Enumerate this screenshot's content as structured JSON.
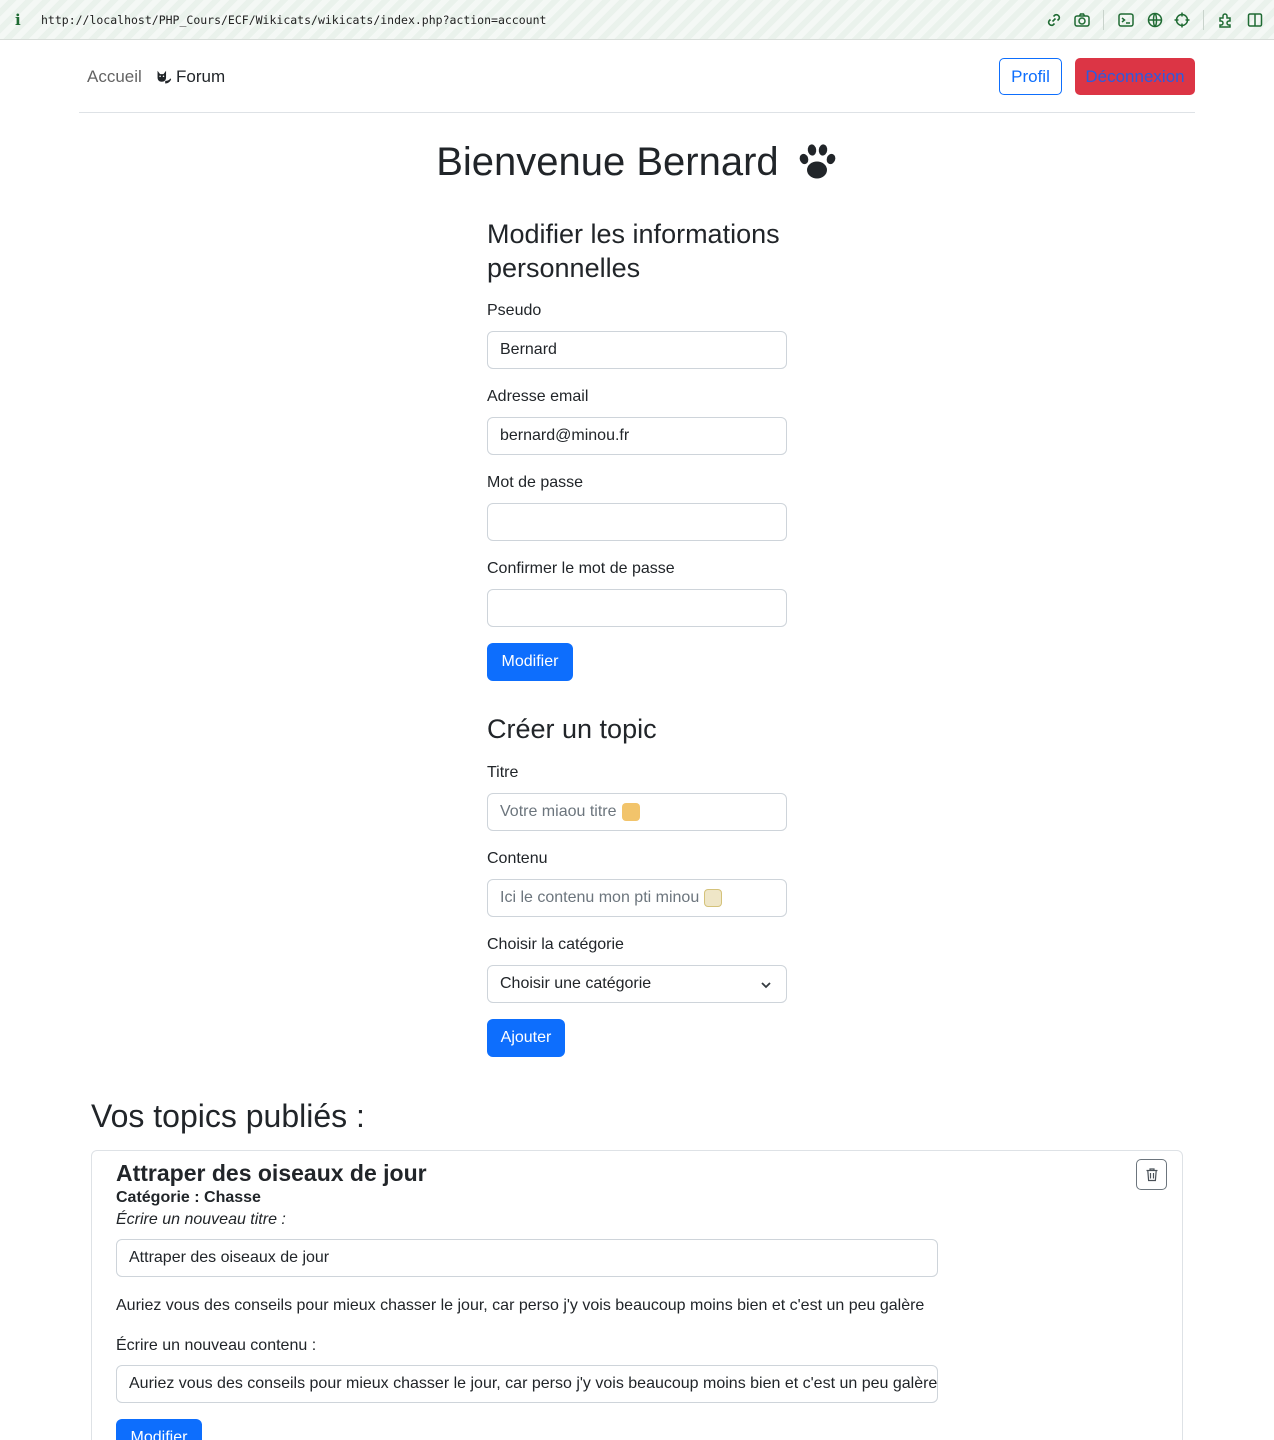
{
  "browser": {
    "info_icon": "i",
    "url": "http://localhost/PHP_Cours/ECF/Wikicats/wikicats/index.php?action=account",
    "toolbar_icons": [
      "link-icon",
      "camera-icon",
      "terminal-icon",
      "globe-icon",
      "crosshair-icon",
      "extension-icon",
      "sidebar-icon"
    ]
  },
  "nav": {
    "home": "Accueil",
    "forum": "Forum",
    "profile_button": "Profil",
    "logout_button": "Déconnexion"
  },
  "welcome": "Bienvenue Bernard",
  "profile_form": {
    "title": "Modifier les informations personnelles",
    "username_label": "Pseudo",
    "username_value": "Bernard",
    "email_label": "Adresse email",
    "email_value": "bernard@minou.fr",
    "password_label": "Mot de passe",
    "password_value": "",
    "confirm_label": "Confirmer le mot de passe",
    "confirm_value": "",
    "submit": "Modifier"
  },
  "topic_form": {
    "title": "Créer un topic",
    "title_label": "Titre",
    "title_placeholder": "Votre miaou titre",
    "content_label": "Contenu",
    "content_placeholder": "Ici le contenu mon pti minou",
    "category_label": "Choisir la catégorie",
    "category_selected": "Choisir une catégorie",
    "submit": "Ajouter"
  },
  "published": {
    "heading": "Vos topics publiés :",
    "topics": [
      {
        "title": "Attraper des oiseaux de jour",
        "category": "Catégorie : Chasse",
        "new_title_label": "Écrire un nouveau titre :",
        "new_title_value": "Attraper des oiseaux de jour",
        "content": "Auriez vous des conseils pour mieux chasser le jour, car perso j'y vois beaucoup moins bien et c'est un peu galère",
        "new_content_label": "Écrire un nouveau contenu :",
        "new_content_value": "Auriez vous des conseils pour mieux chasser le jour, car perso j'y vois beaucoup moins bien et c'est un peu galère",
        "submit": "Modifier"
      }
    ]
  },
  "colors": {
    "primary": "#0d6efd",
    "danger": "#dc3545",
    "text": "#212529"
  }
}
